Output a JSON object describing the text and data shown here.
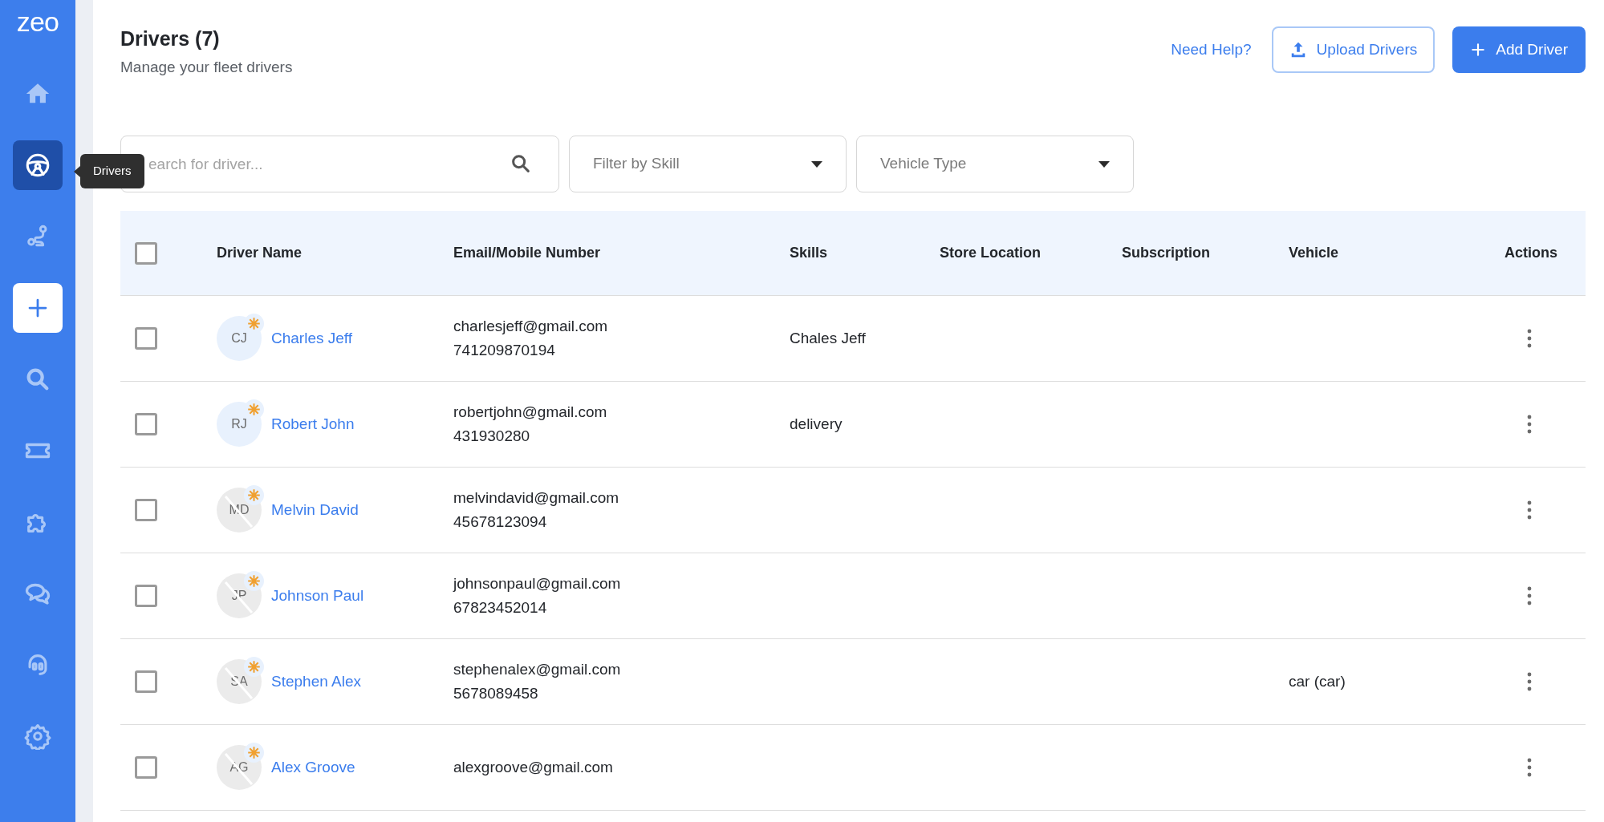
{
  "sidebar": {
    "logo": "zeo",
    "items": [
      {
        "selected": false
      },
      {
        "selected": true
      },
      {
        "selected": false
      },
      {
        "selected": false
      },
      {
        "selected": false
      },
      {
        "selected": false
      },
      {
        "selected": false
      },
      {
        "selected": false
      },
      {
        "selected": false
      },
      {
        "selected": false
      }
    ],
    "tooltip": "Drivers"
  },
  "header": {
    "title": "Drivers (7)",
    "subtitle": "Manage your fleet drivers",
    "help_link": "Need Help?",
    "upload_button": "Upload Drivers",
    "add_button": "Add Driver"
  },
  "filters": {
    "search": {
      "placeholder": "earch for driver..."
    },
    "dropdowns": [
      "Filter by Skill",
      "Vehicle Type"
    ]
  },
  "table": {
    "select_all_checked": false,
    "columns": [
      "Driver Name",
      "Email/Mobile Number",
      "Skills",
      "Store Location",
      "Subscription",
      "Vehicle",
      "Actions"
    ],
    "rows": [
      {
        "checked": false,
        "initials": "CJ",
        "active": true,
        "name": "Charles Jeff",
        "email": "charlesjeff@gmail.com",
        "phone": "741209870194",
        "skills": "Chales Jeff"
      },
      {
        "checked": false,
        "initials": "RJ",
        "active": true,
        "name": "Robert John",
        "email": "robertjohn@gmail.com",
        "phone": "431930280",
        "skills": "delivery"
      },
      {
        "checked": false,
        "initials": "MD",
        "active": false,
        "name": "Melvin David",
        "email": "melvindavid@gmail.com",
        "phone": "45678123094"
      },
      {
        "checked": false,
        "initials": "JP",
        "active": false,
        "name": "Johnson Paul",
        "email": "johnsonpaul@gmail.com",
        "phone": "67823452014"
      },
      {
        "checked": false,
        "initials": "SA",
        "active": false,
        "name": "Stephen Alex",
        "email": "stephenalex@gmail.com",
        "phone": "5678089458",
        "vehicle": "car (car)"
      },
      {
        "checked": false,
        "initials": "AG",
        "active": false,
        "name": "Alex Groove",
        "email": "alexgroove@gmail.com"
      }
    ]
  }
}
